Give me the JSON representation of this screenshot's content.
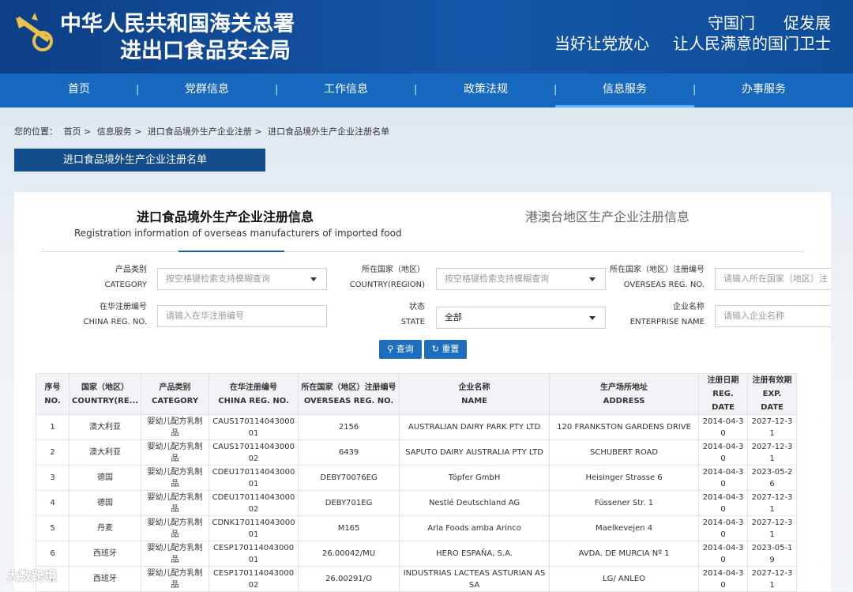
{
  "header": {
    "title_line1": "中华人民共和国海关总署",
    "title_line2": "进出口食品安全局",
    "slogan_a": "守国门",
    "slogan_b": "促发展",
    "slogan_c": "当好让党放心",
    "slogan_d": "让人民满意的国门卫士"
  },
  "nav": [
    "首页",
    "党群信息",
    "工作信息",
    "政策法规",
    "信息服务",
    "办事服务"
  ],
  "breadcrumb": [
    "您的位置：",
    "首页 >",
    "信息服务 >",
    "进口食品境外生产企业注册 >",
    "进口食品境外生产企业注册名单"
  ],
  "section_tab": "进口食品境外生产企业注册名单",
  "tabs": {
    "active_cn": "进口食品境外生产企业注册信息",
    "active_en": "Registration information of overseas manufacturers of imported food",
    "other": "港澳台地区生产企业注册信息"
  },
  "filters": {
    "category_cn": "产品类别",
    "category_en": "CATEGORY",
    "category_ph": "按空格键检索支持模糊查询",
    "country_cn": "所在国家（地区）",
    "country_en": "COUNTRY(REGION)",
    "country_ph": "按空格键检索支持模糊查询",
    "overseas_cn": "所在国家（地区）注册编号",
    "overseas_en": "OVERSEAS REG. NO.",
    "overseas_ph": "请输入所在国家（地区）注",
    "china_cn": "在华注册编号",
    "china_en": "CHINA REG. NO.",
    "china_ph": "请输入在华注册编号",
    "state_cn": "状态",
    "state_en": "STATE",
    "state_value": "全部",
    "name_cn": "企业名称",
    "name_en": "ENTERPRISE NAME",
    "name_ph": "请输入企业名称",
    "search_btn": "查询",
    "reset_btn": "重置"
  },
  "table": {
    "headers": [
      {
        "cn": "序号",
        "en": "NO."
      },
      {
        "cn": "国家（地区）",
        "en": "COUNTRY(RE..."
      },
      {
        "cn": "产品类别",
        "en": "CATEGORY"
      },
      {
        "cn": "在华注册编号",
        "en": "CHINA REG. NO."
      },
      {
        "cn": "所在国家（地区）注册编号",
        "en": "OVERSEAS REG. NO."
      },
      {
        "cn": "企业名称",
        "en": "NAME"
      },
      {
        "cn": "生产场所地址",
        "en": "ADDRESS"
      },
      {
        "cn": "注册日期",
        "en": "REG. DATE"
      },
      {
        "cn": "注册有效期",
        "en": "EXP. DATE"
      }
    ],
    "rows": [
      [
        "1",
        "澳大利亚",
        "婴幼儿配方乳制品",
        "CAUS17011404300001",
        "2156",
        "AUSTRALIAN DAIRY PARK PTY LTD",
        "120 FRANKSTON GARDENS DRIVE",
        "2014-04-30",
        "2027-12-31"
      ],
      [
        "2",
        "澳大利亚",
        "婴幼儿配方乳制品",
        "CAUS17011404300002",
        "6439",
        "SAPUTO DAIRY AUSTRALIA PTY LTD",
        "SCHUBERT ROAD",
        "2014-04-30",
        "2027-12-31"
      ],
      [
        "3",
        "德国",
        "婴幼儿配方乳制品",
        "CDEU17011404300001",
        "DEBY70076EG",
        "Töpfer GmbH",
        "Heisinger Strasse 6",
        "2014-04-30",
        "2023-05-26"
      ],
      [
        "4",
        "德国",
        "婴幼儿配方乳制品",
        "CDEU17011404300002",
        "DEBY701EG",
        "Nestlé Deutschland AG",
        "Füssener Str. 1",
        "2014-04-30",
        "2027-12-31"
      ],
      [
        "5",
        "丹麦",
        "婴幼儿配方乳制品",
        "CDNK17011404300001",
        "M165",
        "Arla Foods amba Arinco",
        "Maelkevejen 4",
        "2014-04-30",
        "2027-12-31"
      ],
      [
        "6",
        "西班牙",
        "婴幼儿配方乳制品",
        "CESP17011404300001",
        "26.00042/MU",
        "HERO ESPAÑA, S.A.",
        "AVDA. DE MURCIA Nº 1",
        "2014-04-30",
        "2023-05-19"
      ],
      [
        "7",
        "西班牙",
        "婴幼儿配方乳制品",
        "CESP17011404300002",
        "26.00291/O",
        "INDUSTRIAS LACTEAS ASTURIAN AS SA",
        "LG/ ANLEO",
        "2014-04-30",
        "2027-12-31"
      ]
    ]
  },
  "watermark": "大数跨境",
  "colors": {
    "header_bg": "#1556a8",
    "nav_bg": "#1769bf",
    "tab_bg": "#144d8c",
    "button": "#1d6fbe"
  }
}
